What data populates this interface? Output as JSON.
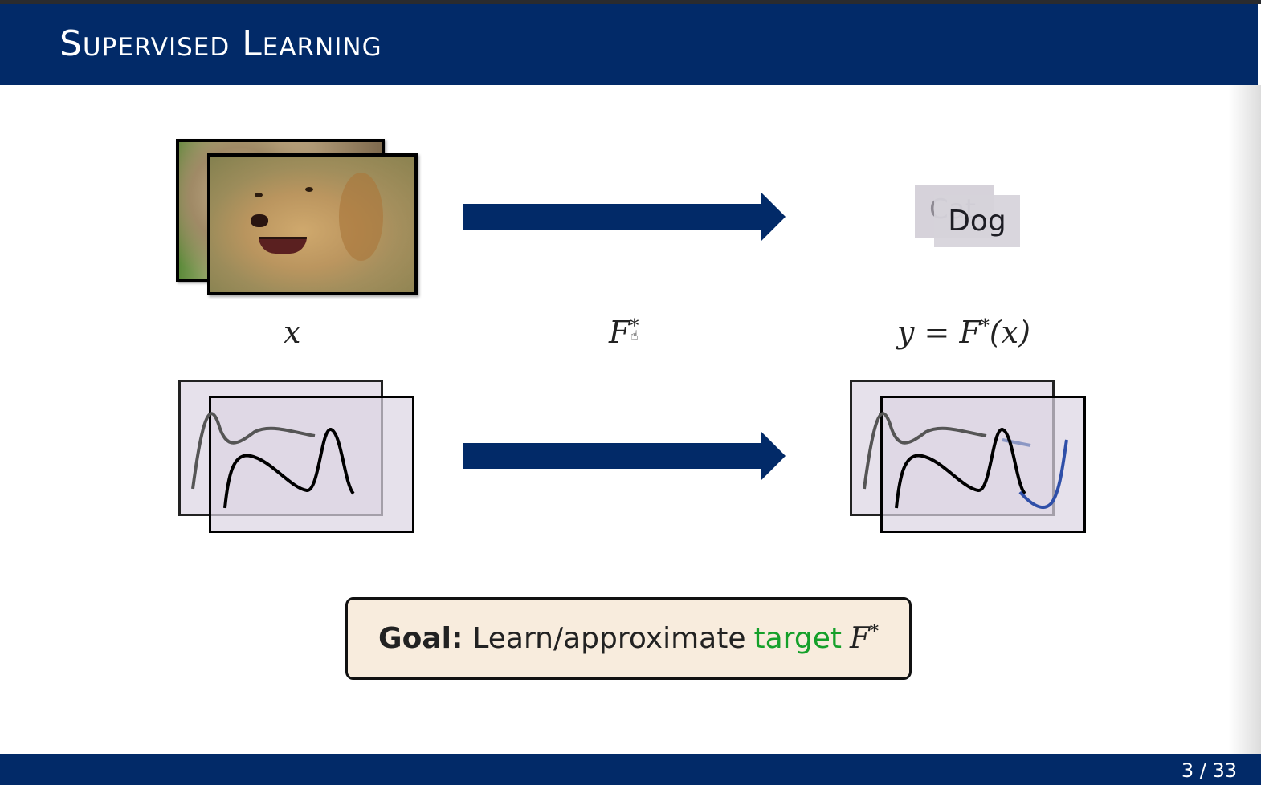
{
  "slide": {
    "title": "Supervised Learning",
    "page": "3 / 33"
  },
  "top_row": {
    "label_back": "Cat",
    "label_front": "Dog"
  },
  "math_labels": {
    "x": "x",
    "f_base": "F",
    "f_sup": "*",
    "y_left": "y = F",
    "y_sup": "*",
    "y_right": "(x)"
  },
  "goal": {
    "strong": "Goal:",
    "text": "Learn/approximate",
    "target": "target",
    "f_base": "F",
    "f_sup": "*"
  },
  "colors": {
    "header_bg": "#022a68",
    "arrow": "#022a68",
    "target_text": "#15a02a",
    "prediction_curve": "#2f4fa8"
  }
}
